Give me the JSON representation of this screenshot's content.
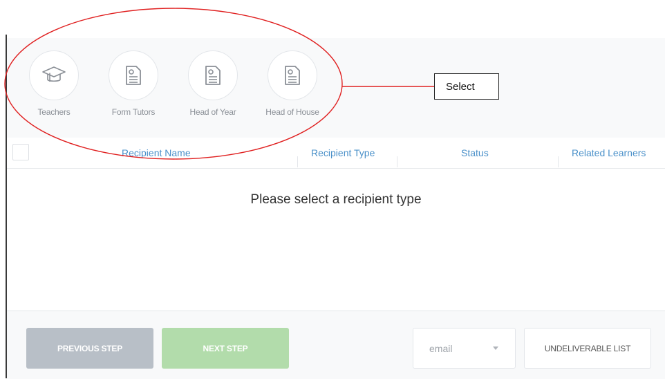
{
  "recipient_types": [
    {
      "label": "Teachers",
      "icon": "graduation-cap-icon"
    },
    {
      "label": "Form Tutors",
      "icon": "document-icon"
    },
    {
      "label": "Head of Year",
      "icon": "document-icon"
    },
    {
      "label": "Head of House",
      "icon": "document-icon"
    }
  ],
  "table": {
    "columns": [
      "Recipient Name",
      "Recipient Type",
      "Status",
      "Related Learners"
    ],
    "empty_message": "Please select a recipient type"
  },
  "footer": {
    "previous_label": "PREVIOUS STEP",
    "next_label": "NEXT STEP",
    "channel_value": "email",
    "undeliverable_label": "UNDELIVERABLE LIST"
  },
  "annotation": {
    "callout_text": "Select",
    "color": "#e02020"
  },
  "colors": {
    "header_text": "#4a90c9",
    "prev_button": "#b8bfc7",
    "next_button": "#b2dcab"
  }
}
